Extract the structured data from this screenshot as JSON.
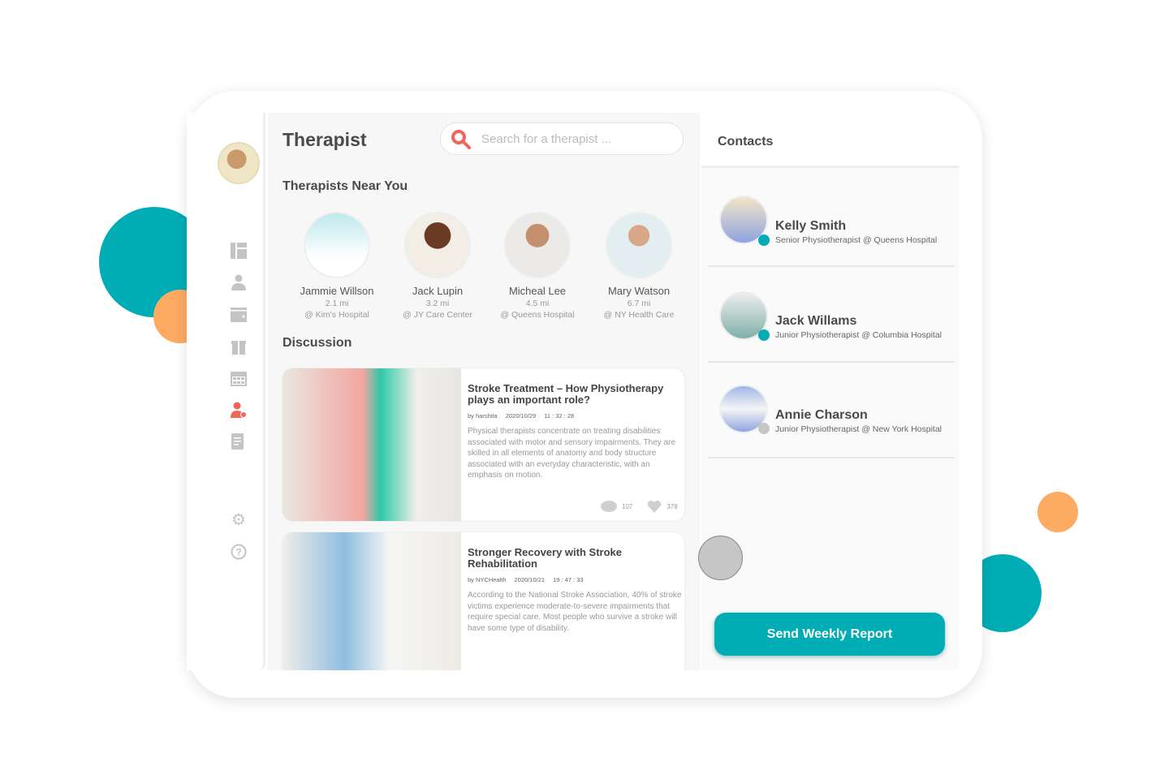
{
  "colors": {
    "accent": "#00adb5",
    "orange": "#fdab63",
    "active_icon": "#f0665c"
  },
  "header": {
    "title": "Therapist",
    "search_placeholder": "Search for a therapist ..."
  },
  "sidebar": {
    "items": [
      {
        "icon": "dashboard-icon"
      },
      {
        "icon": "user-icon"
      },
      {
        "icon": "wallet-icon"
      },
      {
        "icon": "gift-icon"
      },
      {
        "icon": "calendar-icon"
      },
      {
        "icon": "therapist-icon",
        "active": true
      },
      {
        "icon": "report-icon"
      },
      {
        "icon": "gear-icon"
      },
      {
        "icon": "help-icon"
      }
    ]
  },
  "near": {
    "heading": "Therapists Near You",
    "items": [
      {
        "name": "Jammie Willson",
        "distance": "2.1 mi",
        "place": "@ Kim's Hospital"
      },
      {
        "name": "Jack Lupin",
        "distance": "3.2 mi",
        "place": "@ JY Care Center"
      },
      {
        "name": "Micheal Lee",
        "distance": "4.5 mi",
        "place": "@ Queens Hospital"
      },
      {
        "name": "Mary Watson",
        "distance": "6.7 mi",
        "place": "@ NY Health Care"
      }
    ]
  },
  "discussion": {
    "heading": "Discussion",
    "posts": [
      {
        "title": "Stroke Treatment – How Physiotherapy plays an important role?",
        "author": "by harshita",
        "date": "2020/10/29",
        "time": "11 : 32 : 28",
        "body": "Physical therapists concentrate on treating disabilities associated with motor and sensory impairments. They are skilled in all elements of anatomy and body structure associated with an everyday characteristic, with an emphasis on motion.",
        "comments": "107",
        "likes": "378"
      },
      {
        "title": "Stronger Recovery with Stroke Rehabilitation",
        "author": "by NYCHealth",
        "date": "2020/10/21",
        "time": "19 : 47 : 33",
        "body": "According to the National Stroke Association, 40% of stroke victims experience moderate-to-severe impairments that require special care. Most people who survive a stroke will have some type of disability."
      }
    ]
  },
  "contacts": {
    "heading": "Contacts",
    "items": [
      {
        "name": "Kelly Smith",
        "role": "Senior Physiotherapist @ Queens Hospital",
        "status": "online"
      },
      {
        "name": "Jack Willams",
        "role": "Junior Physiotherapist @ Columbia Hospital",
        "status": "online"
      },
      {
        "name": "Annie Charson",
        "role": "Junior Physiotherapist @ New York Hospital",
        "status": "offline"
      }
    ]
  },
  "send_button": "Send Weekly Report"
}
